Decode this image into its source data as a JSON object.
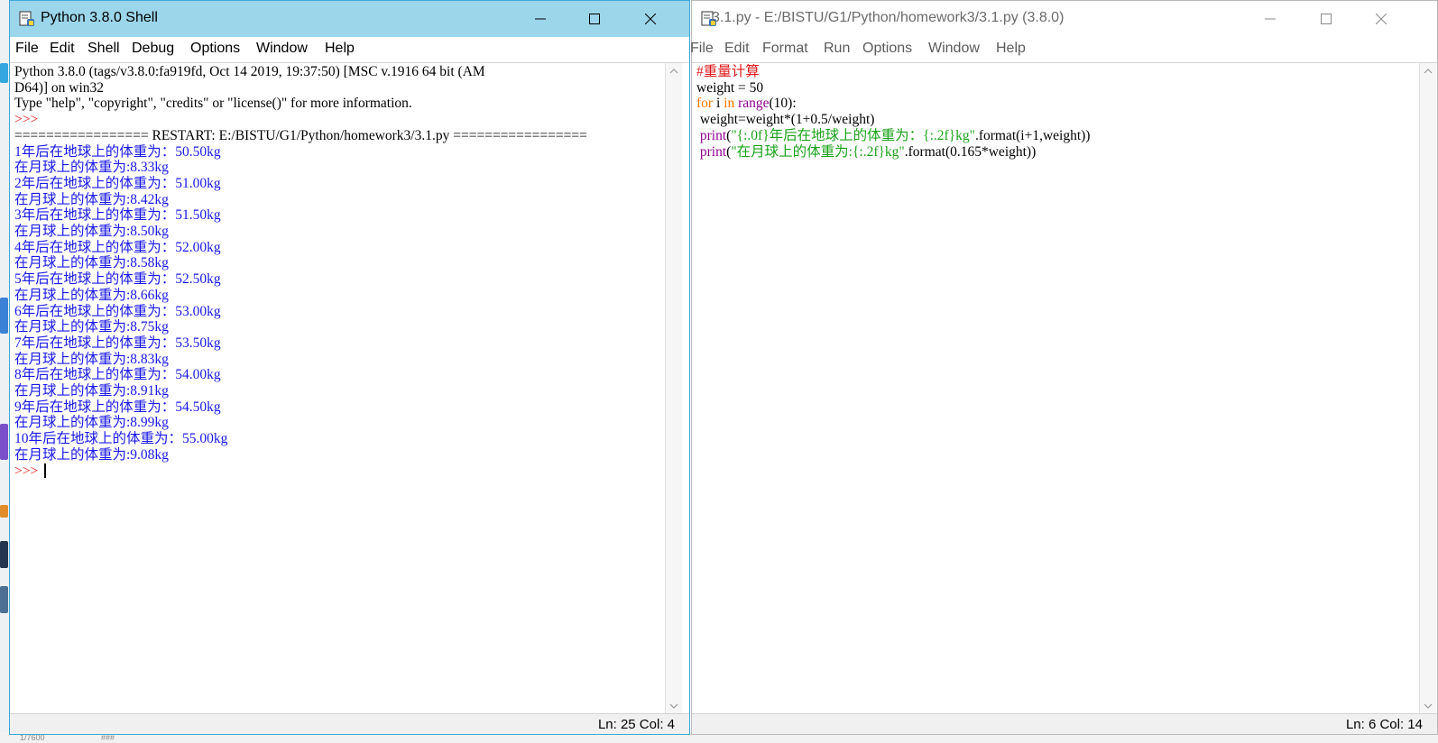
{
  "colors": {
    "accent": "#9cd6ea",
    "output_blue": "#1a1ae6",
    "prompt_red": "#e01b1b",
    "keyword_orange": "#ff7700",
    "builtin_purple": "#900090",
    "string_green": "#1ba31b"
  },
  "shell": {
    "title": "Python 3.8.0 Shell",
    "menu": [
      "File",
      "Edit",
      "Shell",
      "Debug",
      "Options",
      "Window",
      "Help"
    ],
    "lines": [
      {
        "text": "Python 3.8.0 (tags/v3.8.0:fa919fd, Oct 14 2019, 19:37:50) [MSC v.1916 64 bit (AM",
        "color": "black"
      },
      {
        "text": "D64)] on win32",
        "color": "black"
      },
      {
        "text": "Type \"help\", \"copyright\", \"credits\" or \"license()\" for more information.",
        "color": "black"
      },
      {
        "text": ">>> ",
        "color": "red"
      },
      {
        "text": "================= RESTART: E:/BISTU/G1/Python/homework3/3.1.py =================",
        "color": "black"
      },
      {
        "text": "1年后在地球上的体重为：50.50kg",
        "color": "blue"
      },
      {
        "text": "在月球上的体重为:8.33kg",
        "color": "blue"
      },
      {
        "text": "2年后在地球上的体重为：51.00kg",
        "color": "blue"
      },
      {
        "text": "在月球上的体重为:8.42kg",
        "color": "blue"
      },
      {
        "text": "3年后在地球上的体重为：51.50kg",
        "color": "blue"
      },
      {
        "text": "在月球上的体重为:8.50kg",
        "color": "blue"
      },
      {
        "text": "4年后在地球上的体重为：52.00kg",
        "color": "blue"
      },
      {
        "text": "在月球上的体重为:8.58kg",
        "color": "blue"
      },
      {
        "text": "5年后在地球上的体重为：52.50kg",
        "color": "blue"
      },
      {
        "text": "在月球上的体重为:8.66kg",
        "color": "blue"
      },
      {
        "text": "6年后在地球上的体重为：53.00kg",
        "color": "blue"
      },
      {
        "text": "在月球上的体重为:8.75kg",
        "color": "blue"
      },
      {
        "text": "7年后在地球上的体重为：53.50kg",
        "color": "blue"
      },
      {
        "text": "在月球上的体重为:8.83kg",
        "color": "blue"
      },
      {
        "text": "8年后在地球上的体重为：54.00kg",
        "color": "blue"
      },
      {
        "text": "在月球上的体重为:8.91kg",
        "color": "blue"
      },
      {
        "text": "9年后在地球上的体重为：54.50kg",
        "color": "blue"
      },
      {
        "text": "在月球上的体重为:8.99kg",
        "color": "blue"
      },
      {
        "text": "10年后在地球上的体重为：55.00kg",
        "color": "blue"
      },
      {
        "text": "在月球上的体重为:9.08kg",
        "color": "blue"
      }
    ],
    "prompt": ">>> ",
    "status": "Ln: 25  Col: 4"
  },
  "editor": {
    "title": "3.1.py - E:/BISTU/G1/Python/homework3/3.1.py (3.8.0)",
    "menu": [
      "File",
      "Edit",
      "Format",
      "Run",
      "Options",
      "Window",
      "Help"
    ],
    "code": [
      [
        {
          "t": "#重量计算",
          "c": "red"
        }
      ],
      [
        {
          "t": "weight = 50",
          "c": "black"
        }
      ],
      [
        {
          "t": "for",
          "c": "orange"
        },
        {
          "t": " i ",
          "c": "black"
        },
        {
          "t": "in",
          "c": "orange"
        },
        {
          "t": " ",
          "c": "black"
        },
        {
          "t": "range",
          "c": "purple"
        },
        {
          "t": "(10):",
          "c": "black"
        }
      ],
      [
        {
          "t": " weight=weight*(1+0.5/weight)",
          "c": "black"
        }
      ],
      [
        {
          "t": " ",
          "c": "black"
        },
        {
          "t": "print",
          "c": "purple"
        },
        {
          "t": "(",
          "c": "black"
        },
        {
          "t": "\"{:.0f}年后在地球上的体重为：{:.2f}kg\"",
          "c": "green"
        },
        {
          "t": ".format(i+1,weight))",
          "c": "black"
        }
      ],
      [
        {
          "t": " ",
          "c": "black"
        },
        {
          "t": "print",
          "c": "purple"
        },
        {
          "t": "(",
          "c": "black"
        },
        {
          "t": "\"在月球上的体重为:{:.2f}kg\"",
          "c": "green"
        },
        {
          "t": ".format(0.165*weight))",
          "c": "black"
        }
      ]
    ],
    "status": "Ln: 6  Col: 14"
  },
  "desktop": {
    "bottom_fragments": [
      "1/7600",
      "###"
    ]
  }
}
